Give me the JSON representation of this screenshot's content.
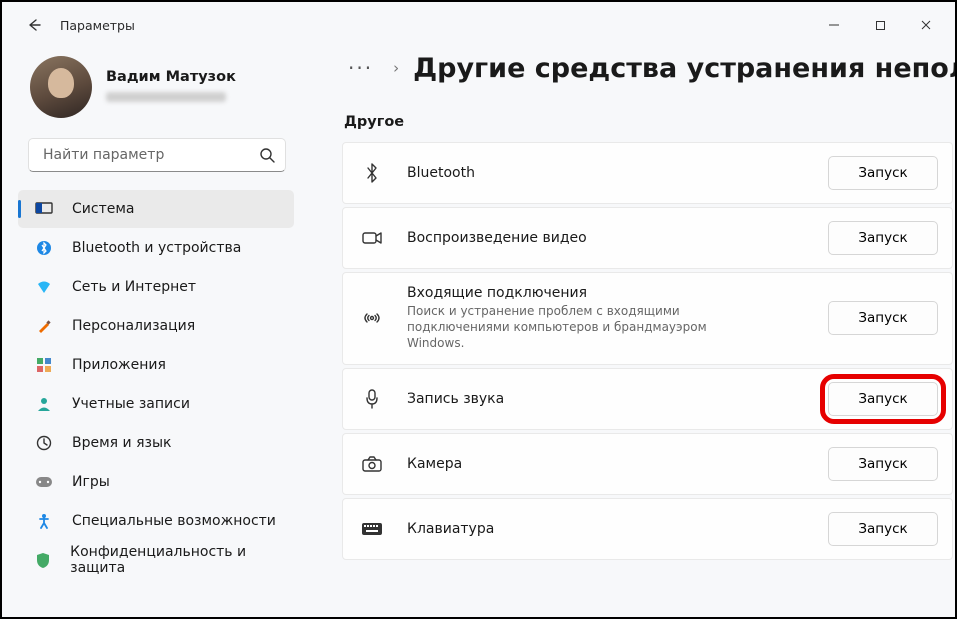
{
  "app_title": "Параметры",
  "user": {
    "name": "Вадим Матузок"
  },
  "search": {
    "placeholder": "Найти параметр"
  },
  "sidebar": {
    "items": [
      {
        "label": "Система",
        "icon": "system",
        "active": true
      },
      {
        "label": "Bluetooth и устройства",
        "icon": "bluetooth",
        "active": false
      },
      {
        "label": "Сеть и Интернет",
        "icon": "network",
        "active": false
      },
      {
        "label": "Персонализация",
        "icon": "personalize",
        "active": false
      },
      {
        "label": "Приложения",
        "icon": "apps",
        "active": false
      },
      {
        "label": "Учетные записи",
        "icon": "accounts",
        "active": false
      },
      {
        "label": "Время и язык",
        "icon": "time",
        "active": false
      },
      {
        "label": "Игры",
        "icon": "gaming",
        "active": false
      },
      {
        "label": "Специальные возможности",
        "icon": "access",
        "active": false
      },
      {
        "label": "Конфиденциальность и защита",
        "icon": "privacy",
        "active": false
      }
    ]
  },
  "breadcrumb": {
    "more": "···",
    "title": "Другие средства устранения неполадок"
  },
  "section": {
    "other": "Другое"
  },
  "run_label": "Запуск",
  "items": [
    {
      "title": "Bluetooth",
      "desc": "",
      "highlight": false
    },
    {
      "title": "Воспроизведение видео",
      "desc": "",
      "highlight": false
    },
    {
      "title": "Входящие подключения",
      "desc": "Поиск и устранение проблем с входящими подключениями компьютеров и брандмауэром Windows.",
      "highlight": false
    },
    {
      "title": "Запись звука",
      "desc": "",
      "highlight": true
    },
    {
      "title": "Камера",
      "desc": "",
      "highlight": false
    },
    {
      "title": "Клавиатура",
      "desc": "",
      "highlight": false
    }
  ]
}
